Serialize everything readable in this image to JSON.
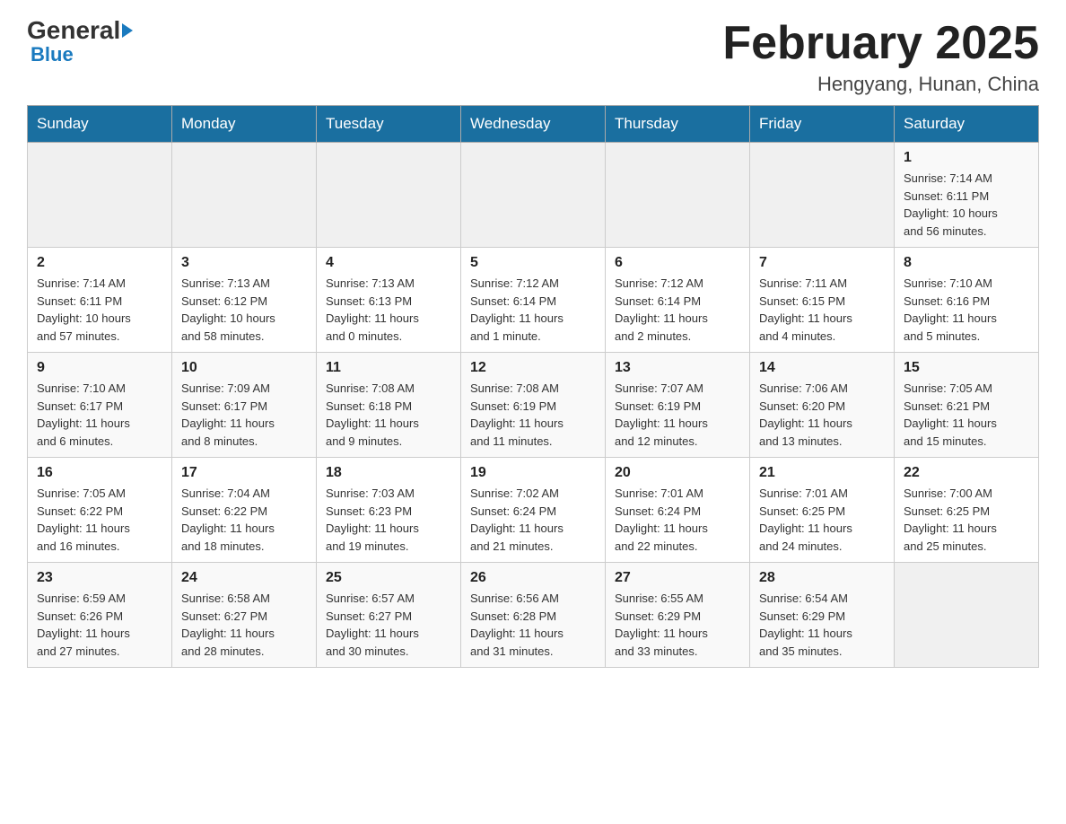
{
  "header": {
    "logo_general": "General",
    "logo_blue": "Blue",
    "month_title": "February 2025",
    "location": "Hengyang, Hunan, China"
  },
  "weekdays": [
    "Sunday",
    "Monday",
    "Tuesday",
    "Wednesday",
    "Thursday",
    "Friday",
    "Saturday"
  ],
  "weeks": [
    [
      {
        "day": "",
        "info": ""
      },
      {
        "day": "",
        "info": ""
      },
      {
        "day": "",
        "info": ""
      },
      {
        "day": "",
        "info": ""
      },
      {
        "day": "",
        "info": ""
      },
      {
        "day": "",
        "info": ""
      },
      {
        "day": "1",
        "info": "Sunrise: 7:14 AM\nSunset: 6:11 PM\nDaylight: 10 hours\nand 56 minutes."
      }
    ],
    [
      {
        "day": "2",
        "info": "Sunrise: 7:14 AM\nSunset: 6:11 PM\nDaylight: 10 hours\nand 57 minutes."
      },
      {
        "day": "3",
        "info": "Sunrise: 7:13 AM\nSunset: 6:12 PM\nDaylight: 10 hours\nand 58 minutes."
      },
      {
        "day": "4",
        "info": "Sunrise: 7:13 AM\nSunset: 6:13 PM\nDaylight: 11 hours\nand 0 minutes."
      },
      {
        "day": "5",
        "info": "Sunrise: 7:12 AM\nSunset: 6:14 PM\nDaylight: 11 hours\nand 1 minute."
      },
      {
        "day": "6",
        "info": "Sunrise: 7:12 AM\nSunset: 6:14 PM\nDaylight: 11 hours\nand 2 minutes."
      },
      {
        "day": "7",
        "info": "Sunrise: 7:11 AM\nSunset: 6:15 PM\nDaylight: 11 hours\nand 4 minutes."
      },
      {
        "day": "8",
        "info": "Sunrise: 7:10 AM\nSunset: 6:16 PM\nDaylight: 11 hours\nand 5 minutes."
      }
    ],
    [
      {
        "day": "9",
        "info": "Sunrise: 7:10 AM\nSunset: 6:17 PM\nDaylight: 11 hours\nand 6 minutes."
      },
      {
        "day": "10",
        "info": "Sunrise: 7:09 AM\nSunset: 6:17 PM\nDaylight: 11 hours\nand 8 minutes."
      },
      {
        "day": "11",
        "info": "Sunrise: 7:08 AM\nSunset: 6:18 PM\nDaylight: 11 hours\nand 9 minutes."
      },
      {
        "day": "12",
        "info": "Sunrise: 7:08 AM\nSunset: 6:19 PM\nDaylight: 11 hours\nand 11 minutes."
      },
      {
        "day": "13",
        "info": "Sunrise: 7:07 AM\nSunset: 6:19 PM\nDaylight: 11 hours\nand 12 minutes."
      },
      {
        "day": "14",
        "info": "Sunrise: 7:06 AM\nSunset: 6:20 PM\nDaylight: 11 hours\nand 13 minutes."
      },
      {
        "day": "15",
        "info": "Sunrise: 7:05 AM\nSunset: 6:21 PM\nDaylight: 11 hours\nand 15 minutes."
      }
    ],
    [
      {
        "day": "16",
        "info": "Sunrise: 7:05 AM\nSunset: 6:22 PM\nDaylight: 11 hours\nand 16 minutes."
      },
      {
        "day": "17",
        "info": "Sunrise: 7:04 AM\nSunset: 6:22 PM\nDaylight: 11 hours\nand 18 minutes."
      },
      {
        "day": "18",
        "info": "Sunrise: 7:03 AM\nSunset: 6:23 PM\nDaylight: 11 hours\nand 19 minutes."
      },
      {
        "day": "19",
        "info": "Sunrise: 7:02 AM\nSunset: 6:24 PM\nDaylight: 11 hours\nand 21 minutes."
      },
      {
        "day": "20",
        "info": "Sunrise: 7:01 AM\nSunset: 6:24 PM\nDaylight: 11 hours\nand 22 minutes."
      },
      {
        "day": "21",
        "info": "Sunrise: 7:01 AM\nSunset: 6:25 PM\nDaylight: 11 hours\nand 24 minutes."
      },
      {
        "day": "22",
        "info": "Sunrise: 7:00 AM\nSunset: 6:25 PM\nDaylight: 11 hours\nand 25 minutes."
      }
    ],
    [
      {
        "day": "23",
        "info": "Sunrise: 6:59 AM\nSunset: 6:26 PM\nDaylight: 11 hours\nand 27 minutes."
      },
      {
        "day": "24",
        "info": "Sunrise: 6:58 AM\nSunset: 6:27 PM\nDaylight: 11 hours\nand 28 minutes."
      },
      {
        "day": "25",
        "info": "Sunrise: 6:57 AM\nSunset: 6:27 PM\nDaylight: 11 hours\nand 30 minutes."
      },
      {
        "day": "26",
        "info": "Sunrise: 6:56 AM\nSunset: 6:28 PM\nDaylight: 11 hours\nand 31 minutes."
      },
      {
        "day": "27",
        "info": "Sunrise: 6:55 AM\nSunset: 6:29 PM\nDaylight: 11 hours\nand 33 minutes."
      },
      {
        "day": "28",
        "info": "Sunrise: 6:54 AM\nSunset: 6:29 PM\nDaylight: 11 hours\nand 35 minutes."
      },
      {
        "day": "",
        "info": ""
      }
    ]
  ]
}
